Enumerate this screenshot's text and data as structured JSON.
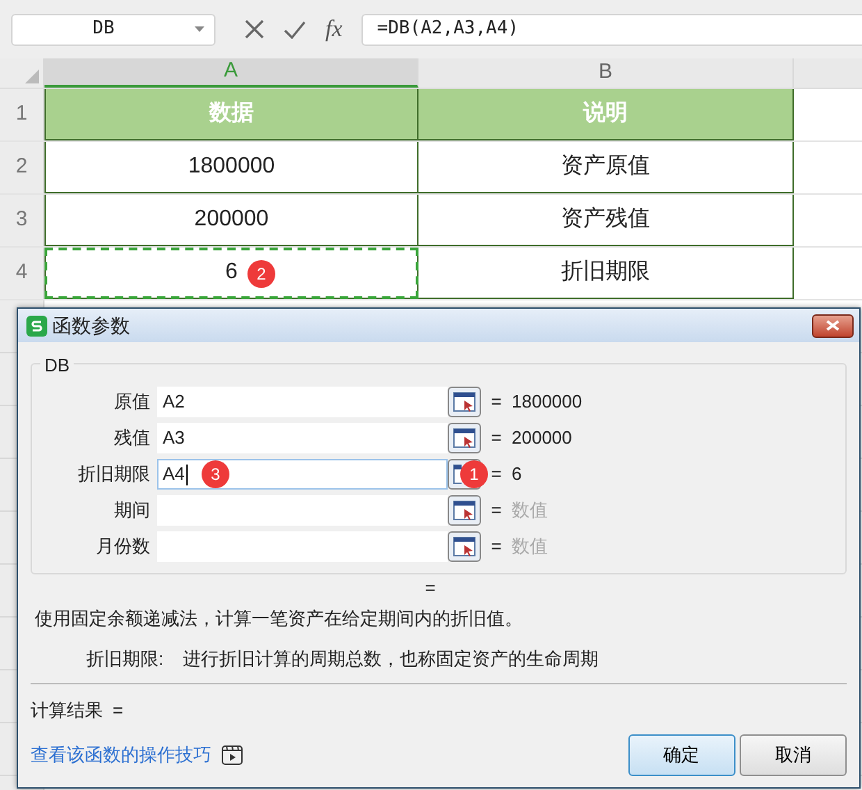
{
  "formula_bar": {
    "name_box": "DB",
    "fx_label": "fx",
    "formula": "=DB(A2,A3,A4)"
  },
  "columns": [
    {
      "label": "A",
      "selected": true
    },
    {
      "label": "B",
      "selected": false
    }
  ],
  "rows": [
    {
      "number": "1",
      "kind": "header",
      "cells": [
        {
          "text": "数据",
          "referenced": false
        },
        {
          "text": "说明",
          "referenced": false
        }
      ]
    },
    {
      "number": "2",
      "kind": "data",
      "cells": [
        {
          "text": "1800000",
          "referenced": false
        },
        {
          "text": "资产原值",
          "referenced": false
        }
      ]
    },
    {
      "number": "3",
      "kind": "data",
      "cells": [
        {
          "text": "200000",
          "referenced": false
        },
        {
          "text": "资产残值",
          "referenced": false
        }
      ]
    },
    {
      "number": "4",
      "kind": "data",
      "cells": [
        {
          "text": "6",
          "referenced": true,
          "marker": "2"
        },
        {
          "text": "折旧期限",
          "referenced": false
        }
      ]
    }
  ],
  "dialog": {
    "title": "函数参数",
    "group": "DB",
    "arguments": [
      {
        "label": "原值",
        "value": "A2",
        "focused": false,
        "result": "1800000",
        "result_is_hint": false
      },
      {
        "label": "残值",
        "value": "A3",
        "focused": false,
        "result": "200000",
        "result_is_hint": false
      },
      {
        "label": "折旧期限",
        "value": "A4",
        "focused": true,
        "field_marker": "3",
        "button_marker": "1",
        "result": "6",
        "result_is_hint": false
      },
      {
        "label": "期间",
        "focused": false,
        "result": "数值",
        "result_is_hint": true
      },
      {
        "label": "月份数",
        "focused": false,
        "result": "数值",
        "result_is_hint": true
      }
    ],
    "formula_result": "=",
    "description": "使用固定余额递减法，计算一笔资产在给定期间内的折旧值。",
    "argument_help": {
      "label": "折旧期限:",
      "text": "进行折旧计算的周期总数，也称固定资产的生命周期"
    },
    "result_label": "计算结果",
    "result_equals": "=",
    "help_link": "查看该函数的操作技巧",
    "buttons": [
      {
        "label": "确定",
        "default": true
      },
      {
        "label": "取消",
        "default": false
      }
    ]
  }
}
